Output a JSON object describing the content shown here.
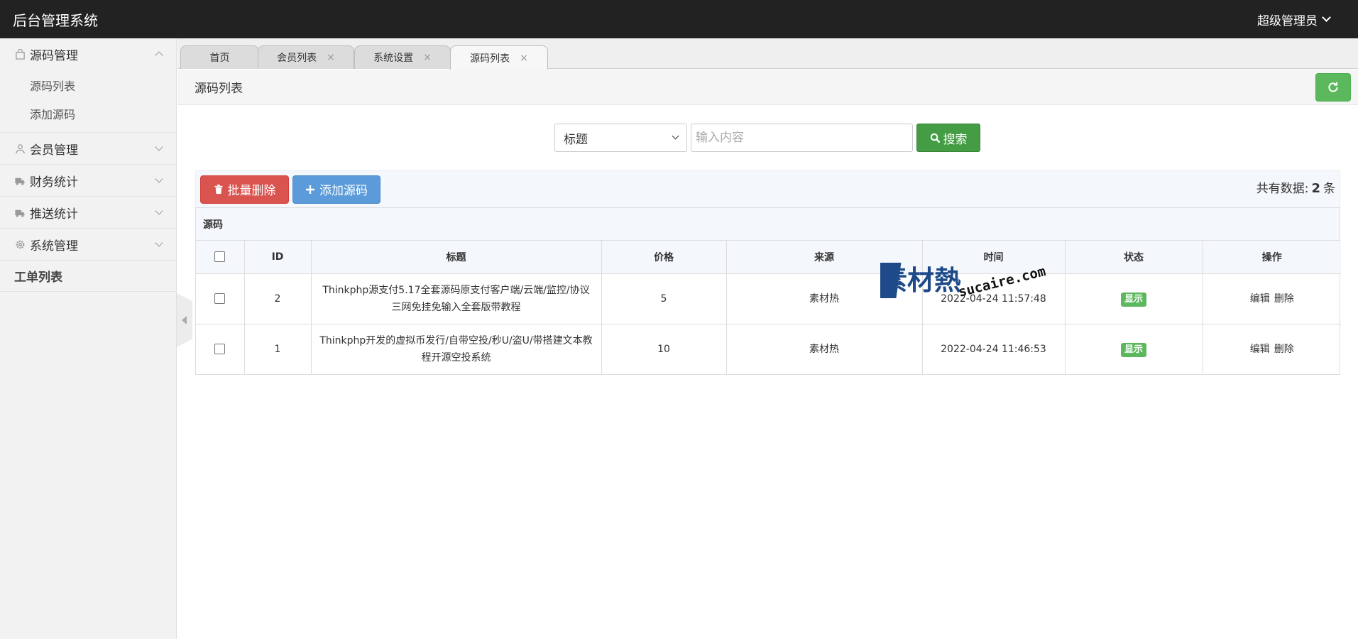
{
  "app": {
    "title": "后台管理系统",
    "user": "超级管理员"
  },
  "sidebar": {
    "groups": [
      {
        "label": "源码管理",
        "icon": "bag-icon",
        "items": [
          "源码列表",
          "添加源码"
        ]
      },
      {
        "label": "会员管理",
        "icon": "user-icon"
      },
      {
        "label": "财务统计",
        "icon": "truck-icon"
      },
      {
        "label": "推送统计",
        "icon": "truck-icon"
      },
      {
        "label": "系统管理",
        "icon": "gear-icon"
      }
    ],
    "bold_item": "工单列表"
  },
  "tabs": [
    {
      "label": "首页",
      "closable": false
    },
    {
      "label": "会员列表",
      "closable": true
    },
    {
      "label": "系统设置",
      "closable": true
    },
    {
      "label": "源码列表",
      "closable": true,
      "active": true
    }
  ],
  "tab_close": "×",
  "page": {
    "title": "源码列表"
  },
  "search": {
    "field": "标题",
    "placeholder": "输入内容",
    "button": "搜索"
  },
  "toolbar": {
    "batch_delete": "批量删除",
    "add": "添加源码",
    "total_prefix": "共有数据:",
    "total_count": "2",
    "total_suffix": "条"
  },
  "table": {
    "caption": "源码",
    "headers": [
      "ID",
      "标题",
      "价格",
      "来源",
      "时间",
      "状态",
      "操作"
    ],
    "rows": [
      {
        "id": "2",
        "title": "Thinkphp源支付5.17全套源码原支付客户端/云端/监控/协议三网免挂免输入全套版带教程",
        "price": "5",
        "source": "素材热",
        "time": "2022-04-24 11:57:48",
        "status": "显示",
        "edit": "编辑",
        "delete": "删除"
      },
      {
        "id": "1",
        "title": "Thinkphp开发的虚拟币发行/自带空投/秒U/盗U/带搭建文本教程开源空投系统",
        "price": "10",
        "source": "素材热",
        "time": "2022-04-24 11:46:53",
        "status": "显示",
        "edit": "编辑",
        "delete": "删除"
      }
    ]
  },
  "watermark": {
    "logo": "素材熱",
    "domain": "sucaire.com"
  },
  "colors": {
    "topbar": "#222222",
    "success": "#5cb85c",
    "search": "#449d44",
    "danger": "#d9534f",
    "primary": "#5b9bd9",
    "watermark": "#1e4a8a"
  }
}
